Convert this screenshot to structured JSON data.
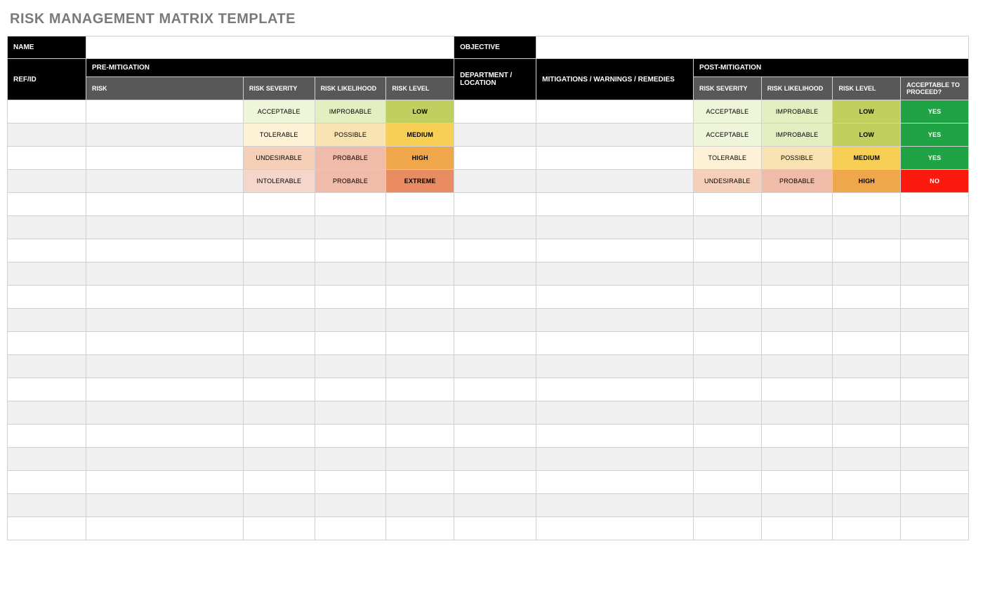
{
  "title": "RISK MANAGEMENT MATRIX TEMPLATE",
  "header": {
    "name_label": "NAME",
    "refid_label": "REF/ID",
    "premit_label": "PRE-MITIGATION",
    "risk_label": "RISK",
    "severity_label": "RISK SEVERITY",
    "likelihood_label": "RISK LIKELIHOOD",
    "level_label": "RISK LEVEL",
    "objective_label": "OBJECTIVE",
    "dept_label": "DEPARTMENT / LOCATION",
    "mitigations_label": "MITIGATIONS / WARNINGS / REMEDIES",
    "postmit_label": "POST-MITIGATION",
    "severity2_label": "RISK SEVERITY",
    "likelihood2_label": "RISK LIKELIHOOD",
    "level2_label": "RISK LEVEL",
    "acceptable_label": "ACCEPTABLE TO PROCEED?"
  },
  "rows": [
    {
      "pre_severity": "ACCEPTABLE",
      "pre_severity_cls": "c-acceptable",
      "pre_likelihood": "IMPROBABLE",
      "pre_likelihood_cls": "c-improbable",
      "pre_level": "LOW",
      "pre_level_cls": "c-low",
      "post_severity": "ACCEPTABLE",
      "post_severity_cls": "c-acceptable",
      "post_likelihood": "IMPROBABLE",
      "post_likelihood_cls": "c-improbable",
      "post_level": "LOW",
      "post_level_cls": "c-low",
      "proceed": "YES",
      "proceed_cls": "c-yes"
    },
    {
      "pre_severity": "TOLERABLE",
      "pre_severity_cls": "c-tolerable",
      "pre_likelihood": "POSSIBLE",
      "pre_likelihood_cls": "c-possible",
      "pre_level": "MEDIUM",
      "pre_level_cls": "c-medium",
      "post_severity": "ACCEPTABLE",
      "post_severity_cls": "c-acceptable",
      "post_likelihood": "IMPROBABLE",
      "post_likelihood_cls": "c-improbable",
      "post_level": "LOW",
      "post_level_cls": "c-low",
      "proceed": "YES",
      "proceed_cls": "c-yes"
    },
    {
      "pre_severity": "UNDESIRABLE",
      "pre_severity_cls": "c-undesirable",
      "pre_likelihood": "PROBABLE",
      "pre_likelihood_cls": "c-probable",
      "pre_level": "HIGH",
      "pre_level_cls": "c-high",
      "post_severity": "TOLERABLE",
      "post_severity_cls": "c-tolerable",
      "post_likelihood": "POSSIBLE",
      "post_likelihood_cls": "c-possible",
      "post_level": "MEDIUM",
      "post_level_cls": "c-medium",
      "proceed": "YES",
      "proceed_cls": "c-yes"
    },
    {
      "pre_severity": "INTOLERABLE",
      "pre_severity_cls": "c-intolerable",
      "pre_likelihood": "PROBABLE",
      "pre_likelihood_cls": "c-probable",
      "pre_level": "EXTREME",
      "pre_level_cls": "c-extreme",
      "post_severity": "UNDESIRABLE",
      "post_severity_cls": "c-undesirable",
      "post_likelihood": "PROBABLE",
      "post_likelihood_cls": "c-probable",
      "post_level": "HIGH",
      "post_level_cls": "c-high",
      "proceed": "NO",
      "proceed_cls": "c-no"
    }
  ],
  "empty_rows": 15
}
